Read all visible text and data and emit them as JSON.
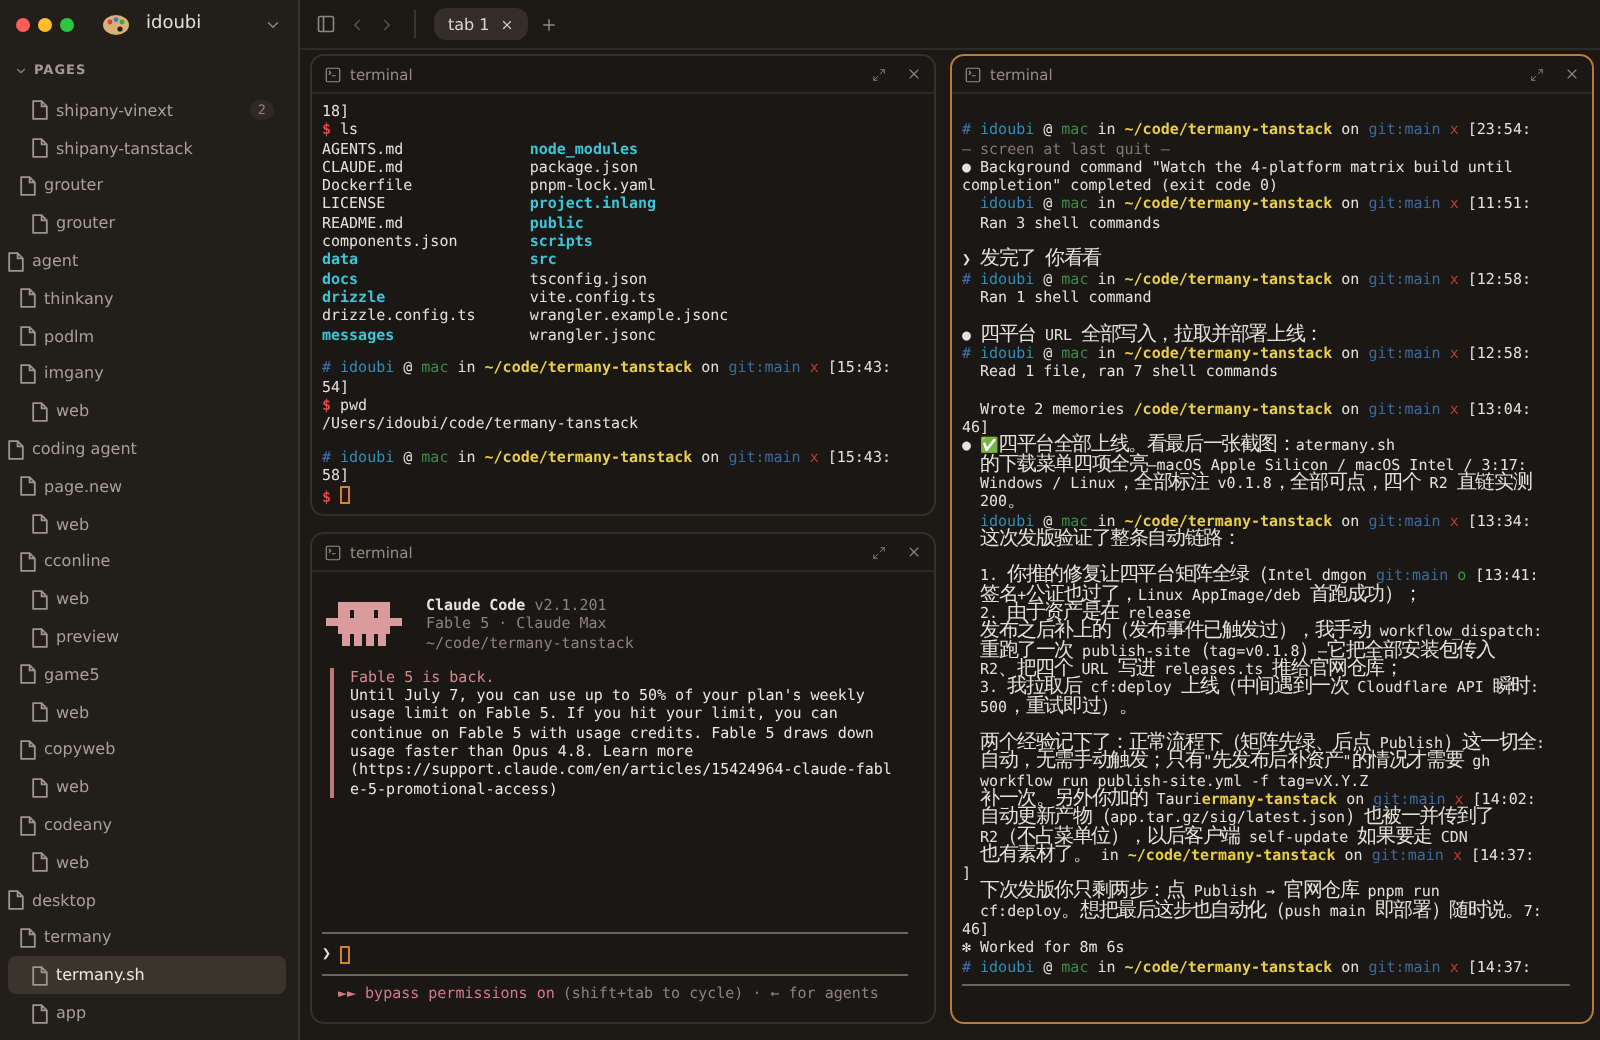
{
  "sidebar": {
    "workspace": "idoubi",
    "section": "PAGES",
    "section_expanded": true,
    "tree": [
      {
        "children": [
          {
            "children": [
              {
                "label": "shipany-vinext",
                "badge": "2",
                "selected": false
              },
              {
                "label": "shipany-tanstack",
                "selected": false
              }
            ]
          },
          {
            "label": "grouter",
            "selected": false,
            "children": [
              {
                "label": "grouter",
                "selected": false
              }
            ]
          }
        ]
      },
      {
        "label": "agent",
        "selected": false,
        "children": [
          {
            "label": "thinkany",
            "selected": false
          },
          {
            "label": "podlm",
            "selected": false
          },
          {
            "label": "imgany",
            "selected": false,
            "children": [
              {
                "label": "web",
                "selected": false
              }
            ]
          }
        ]
      },
      {
        "label": "coding agent",
        "selected": false,
        "children": [
          {
            "label": "page.new",
            "selected": false,
            "children": [
              {
                "label": "web",
                "selected": false
              }
            ]
          },
          {
            "label": "cconline",
            "selected": false,
            "children": [
              {
                "label": "web",
                "selected": false
              },
              {
                "label": "preview",
                "selected": false
              }
            ]
          },
          {
            "label": "game5",
            "selected": false,
            "children": [
              {
                "label": "web",
                "selected": false
              }
            ]
          },
          {
            "label": "copyweb",
            "selected": false,
            "children": [
              {
                "label": "web",
                "selected": false
              }
            ]
          },
          {
            "label": "codeany",
            "selected": false,
            "children": [
              {
                "label": "web",
                "selected": false
              }
            ]
          }
        ]
      },
      {
        "label": "desktop",
        "selected": false,
        "children": [
          {
            "label": "termany",
            "selected": false,
            "children": [
              {
                "label": "termany.sh",
                "selected": true
              },
              {
                "label": "app",
                "selected": false
              }
            ]
          }
        ]
      }
    ]
  },
  "toolbar": {
    "tabs": [
      {
        "label": "tab 1",
        "selected": true
      }
    ]
  },
  "columns": [
    {
      "panes": [
        {
          "kind": "shell",
          "title": "terminal",
          "focused": false,
          "lines": [
            {
              "kind": "text",
              "segments": [
                {
                  "text": "18]",
                  "kind": "plain"
                }
              ]
            },
            {
              "kind": "text",
              "segments": [
                {
                  "text": "$ ",
                  "kind": "dollar"
                },
                {
                  "text": "ls",
                  "kind": "plain"
                }
              ]
            },
            {
              "kind": "listing",
              "entries": [
                {
                  "text": "AGENTS.md",
                  "kind": "file"
                },
                {
                  "text": "node_modules",
                  "kind": "dir"
                },
                {
                  "text": "CLAUDE.md",
                  "kind": "file"
                },
                {
                  "text": "package.json",
                  "kind": "file"
                },
                {
                  "text": "Dockerfile",
                  "kind": "file"
                },
                {
                  "text": "pnpm-lock.yaml",
                  "kind": "file"
                },
                {
                  "text": "LICENSE",
                  "kind": "file"
                },
                {
                  "text": "project.inlang",
                  "kind": "dir"
                },
                {
                  "text": "README.md",
                  "kind": "file"
                },
                {
                  "text": "public",
                  "kind": "dir"
                },
                {
                  "text": "components.json",
                  "kind": "file"
                },
                {
                  "text": "scripts",
                  "kind": "dir"
                },
                {
                  "text": "data",
                  "kind": "dir"
                },
                {
                  "text": "src",
                  "kind": "dir"
                },
                {
                  "text": "docs",
                  "kind": "dir"
                },
                {
                  "text": "tsconfig.json",
                  "kind": "file"
                },
                {
                  "text": "drizzle",
                  "kind": "dir"
                },
                {
                  "text": "vite.config.ts",
                  "kind": "file"
                },
                {
                  "text": "drizzle.config.ts",
                  "kind": "file"
                },
                {
                  "text": "wrangler.example.jsonc",
                  "kind": "file"
                },
                {
                  "text": "messages",
                  "kind": "dir"
                },
                {
                  "text": "wrangler.jsonc",
                  "kind": "file"
                }
              ]
            },
            {
              "kind": "blank"
            },
            {
              "kind": "text",
              "segments": [
                {
                  "text": "# ",
                  "kind": "hash"
                },
                {
                  "text": "idoubi",
                  "kind": "user"
                },
                {
                  "text": " @ ",
                  "kind": "plain"
                },
                {
                  "text": "mac",
                  "kind": "host"
                },
                {
                  "text": " in ",
                  "kind": "plain"
                },
                {
                  "text": "~/code/termany-tanstack",
                  "kind": "path"
                },
                {
                  "text": " on ",
                  "kind": "plain"
                },
                {
                  "text": "git:main",
                  "kind": "branch"
                },
                {
                  "text": " x",
                  "kind": "dirty"
                },
                {
                  "text": " [15:43:",
                  "kind": "plain"
                }
              ]
            },
            {
              "kind": "text",
              "segments": [
                {
                  "text": "54]",
                  "kind": "plain"
                }
              ]
            },
            {
              "kind": "text",
              "segments": [
                {
                  "text": "$ ",
                  "kind": "dollar"
                },
                {
                  "text": "pwd",
                  "kind": "plain"
                }
              ]
            },
            {
              "kind": "text",
              "segments": [
                {
                  "text": "/Users/idoubi/code/termany-tanstack",
                  "kind": "plain"
                }
              ]
            },
            {
              "kind": "blank"
            },
            {
              "kind": "text",
              "segments": [
                {
                  "text": "# ",
                  "kind": "hash"
                },
                {
                  "text": "idoubi",
                  "kind": "user"
                },
                {
                  "text": " @ ",
                  "kind": "plain"
                },
                {
                  "text": "mac",
                  "kind": "host"
                },
                {
                  "text": " in ",
                  "kind": "plain"
                },
                {
                  "text": "~/code/termany-tanstack",
                  "kind": "path"
                },
                {
                  "text": " on ",
                  "kind": "plain"
                },
                {
                  "text": "git:main",
                  "kind": "branch"
                },
                {
                  "text": " x",
                  "kind": "dirty"
                },
                {
                  "text": " [15:43:",
                  "kind": "plain"
                }
              ]
            },
            {
              "kind": "text",
              "segments": [
                {
                  "text": "58]",
                  "kind": "plain"
                }
              ]
            },
            {
              "kind": "input",
              "segments": [
                {
                  "text": "$ ",
                  "kind": "dollar"
                }
              ]
            }
          ]
        },
        {
          "kind": "claude",
          "title": "terminal",
          "focused": false,
          "banner": {
            "name": "Claude Code",
            "version": "v2.1.201",
            "plan": "Fable 5 · Claude Max",
            "cwd": "~/code/termany-tanstack"
          },
          "notice": {
            "title": "Fable 5 is back.",
            "lines": [
              "Until July 7, you can use up to 50% of your plan's weekly",
              "usage limit on Fable 5. If you hit your limit, you can",
              "continue on Fable 5 with usage credits. Fable 5 draws down",
              "usage faster than Opus 4.8. Learn more",
              "(https://support.claude.com/en/articles/15424964-claude-fabl",
              "e-5-promotional-access)"
            ]
          },
          "prompt": "❯",
          "mode": {
            "label": "►► bypass permissions on",
            "hint": "(shift+tab to cycle) · ← for agents"
          }
        }
      ]
    },
    {
      "panes": [
        {
          "kind": "shell",
          "title": "terminal",
          "focused": true,
          "lines": [
            {
              "kind": "blank"
            },
            {
              "kind": "text",
              "segments": [
                {
                  "text": "# ",
                  "kind": "hash"
                },
                {
                  "text": "idoubi",
                  "kind": "user"
                },
                {
                  "text": " @ ",
                  "kind": "plain"
                },
                {
                  "text": "mac",
                  "kind": "host"
                },
                {
                  "text": " in ",
                  "kind": "plain"
                },
                {
                  "text": "~/code/termany-tanstack",
                  "kind": "path"
                },
                {
                  "text": " on ",
                  "kind": "plain"
                },
                {
                  "text": "git:main",
                  "kind": "branch"
                },
                {
                  "text": " x",
                  "kind": "dirty"
                },
                {
                  "text": " [23:54:",
                  "kind": "plain"
                }
              ]
            },
            {
              "kind": "text",
              "segments": [
                {
                  "text": "— screen at last quit —",
                  "kind": "dim"
                }
              ]
            },
            {
              "kind": "text",
              "segments": [
                {
                  "text": "● Background command \"Watch the 4-platform matrix build until",
                  "kind": "plain"
                }
              ]
            },
            {
              "kind": "text",
              "segments": [
                {
                  "text": "completion\" completed (exit code 0)",
                  "kind": "plain"
                }
              ]
            },
            {
              "kind": "text",
              "indent": true,
              "segments": [
                {
                  "text": "idoubi",
                  "kind": "user"
                },
                {
                  "text": " @ ",
                  "kind": "plain"
                },
                {
                  "text": "mac",
                  "kind": "host"
                },
                {
                  "text": " in ",
                  "kind": "plain"
                },
                {
                  "text": "~/code/termany-tanstack",
                  "kind": "path"
                },
                {
                  "text": " on ",
                  "kind": "plain"
                },
                {
                  "text": "git:main",
                  "kind": "branch"
                },
                {
                  "text": " x",
                  "kind": "dirty"
                },
                {
                  "text": " [11:51:",
                  "kind": "plain"
                }
              ]
            },
            {
              "kind": "text",
              "segments": [
                {
                  "text": "  Ran 3 shell commands",
                  "kind": "plain"
                }
              ]
            },
            {
              "kind": "blank"
            },
            {
              "kind": "text",
              "segments": [
                {
                  "text": "❯ 发完了 你看看",
                  "kind": "plain"
                }
              ]
            },
            {
              "kind": "text",
              "segments": [
                {
                  "text": "# ",
                  "kind": "hash"
                },
                {
                  "text": "idoubi",
                  "kind": "user"
                },
                {
                  "text": " @ ",
                  "kind": "plain"
                },
                {
                  "text": "mac",
                  "kind": "host"
                },
                {
                  "text": " in ",
                  "kind": "plain"
                },
                {
                  "text": "~/code/termany-tanstack",
                  "kind": "path"
                },
                {
                  "text": " on ",
                  "kind": "plain"
                },
                {
                  "text": "git:main",
                  "kind": "branch"
                },
                {
                  "text": " x",
                  "kind": "dirty"
                },
                {
                  "text": " [12:58:",
                  "kind": "plain"
                }
              ]
            },
            {
              "kind": "text",
              "segments": [
                {
                  "text": "  Ran 1 shell command",
                  "kind": "plain"
                }
              ]
            },
            {
              "kind": "blank"
            },
            {
              "kind": "text",
              "segments": [
                {
                  "text": "● 四平台 URL 全部写入，拉取并部署上线：",
                  "kind": "plain"
                }
              ]
            },
            {
              "kind": "text",
              "segments": [
                {
                  "text": "# ",
                  "kind": "hash"
                },
                {
                  "text": "idoubi",
                  "kind": "user"
                },
                {
                  "text": " @ ",
                  "kind": "plain"
                },
                {
                  "text": "mac",
                  "kind": "host"
                },
                {
                  "text": " in ",
                  "kind": "plain"
                },
                {
                  "text": "~/code/termany-tanstack",
                  "kind": "path"
                },
                {
                  "text": " on ",
                  "kind": "plain"
                },
                {
                  "text": "git:main",
                  "kind": "branch"
                },
                {
                  "text": " x",
                  "kind": "dirty"
                },
                {
                  "text": " [12:58:",
                  "kind": "plain"
                }
              ]
            },
            {
              "kind": "text",
              "segments": [
                {
                  "text": "  Read 1 file, ran 7 shell commands",
                  "kind": "plain"
                }
              ]
            },
            {
              "kind": "blank"
            },
            {
              "kind": "text",
              "segments": [
                {
                  "text": "  Wrote 2 memories ",
                  "kind": "plain"
                },
                {
                  "text": "/code/termany-tanstack",
                  "kind": "path"
                },
                {
                  "text": " on ",
                  "kind": "plain"
                },
                {
                  "text": "git:main",
                  "kind": "branch"
                },
                {
                  "text": " x",
                  "kind": "dirty"
                },
                {
                  "text": " [13:04:",
                  "kind": "plain"
                }
              ]
            },
            {
              "kind": "text",
              "segments": [
                {
                  "text": "46]",
                  "kind": "plain"
                }
              ]
            },
            {
              "kind": "text",
              "segments": [
                {
                  "text": "● ✅四平台全部上线。看最后一张截图：atermany.sh",
                  "kind": "plain"
                }
              ]
            },
            {
              "kind": "text",
              "segments": [
                {
                  "text": "  的下载菜单四项全亮—macOS Apple Silicon / macOS Intel / 3:17:",
                  "kind": "plain"
                }
              ]
            },
            {
              "kind": "text",
              "segments": [
                {
                  "text": "  Windows / Linux，全部标注 v0.1.8，全部可点，四个 R2 直链实测",
                  "kind": "plain"
                }
              ]
            },
            {
              "kind": "text",
              "segments": [
                {
                  "text": "  200。",
                  "kind": "plain"
                }
              ]
            },
            {
              "kind": "text",
              "indent": true,
              "segments": [
                {
                  "text": "idoubi",
                  "kind": "user"
                },
                {
                  "text": " @ ",
                  "kind": "plain"
                },
                {
                  "text": "mac",
                  "kind": "host"
                },
                {
                  "text": " in ",
                  "kind": "plain"
                },
                {
                  "text": "~/code/termany-tanstack",
                  "kind": "path"
                },
                {
                  "text": " on ",
                  "kind": "plain"
                },
                {
                  "text": "git:main",
                  "kind": "branch"
                },
                {
                  "text": " x",
                  "kind": "dirty"
                },
                {
                  "text": " [13:34:",
                  "kind": "plain"
                }
              ]
            },
            {
              "kind": "text",
              "segments": [
                {
                  "text": "  这次发版验证了整条自动链路：",
                  "kind": "plain"
                }
              ]
            },
            {
              "kind": "blank"
            },
            {
              "kind": "text",
              "segments": [
                {
                  "text": "  1. 你推的修复让四平台矩阵全绿（Intel dmgon ",
                  "kind": "plain"
                },
                {
                  "text": "git:main",
                  "kind": "branch"
                },
                {
                  "text": " o",
                  "kind": "clean"
                },
                {
                  "text": " [13:41:",
                  "kind": "plain"
                }
              ]
            },
            {
              "kind": "text",
              "segments": [
                {
                  "text": "  签名+公证也过了，Linux AppImage/deb 首跑成功）；",
                  "kind": "plain"
                }
              ]
            },
            {
              "kind": "text",
              "segments": [
                {
                  "text": "  2. 由于资产是在 release",
                  "kind": "plain"
                }
              ]
            },
            {
              "kind": "text",
              "segments": [
                {
                  "text": "  发布之后补上的（发布事件已触发过），我手动 workflow_dispatch:",
                  "kind": "plain"
                }
              ]
            },
            {
              "kind": "text",
              "segments": [
                {
                  "text": "  重跑了一次 publish-site（tag=v0.1.8）—它把全部安装包传入",
                  "kind": "plain"
                }
              ]
            },
            {
              "kind": "text",
              "segments": [
                {
                  "text": "  R2、把四个 URL 写进 releases.ts 推给官网仓库；",
                  "kind": "plain"
                }
              ]
            },
            {
              "kind": "text",
              "segments": [
                {
                  "text": "  3. 我拉取后 cf:deploy 上线（中间遇到一次 Cloudflare API 瞬时:",
                  "kind": "plain"
                }
              ]
            },
            {
              "kind": "text",
              "segments": [
                {
                  "text": "  500，重试即过）。",
                  "kind": "plain"
                }
              ]
            },
            {
              "kind": "blank"
            },
            {
              "kind": "text",
              "segments": [
                {
                  "text": "  两个经验记下了：正常流程下（矩阵先绿、后点 Publish）这一切全:",
                  "kind": "plain"
                }
              ]
            },
            {
              "kind": "text",
              "segments": [
                {
                  "text": "  自动，无需手动触发；只有\"先发布后补资产\"的情况才需要 gh",
                  "kind": "plain"
                }
              ]
            },
            {
              "kind": "text",
              "segments": [
                {
                  "text": "  workflow run publish-site.yml -f tag=vX.Y.Z",
                  "kind": "plain"
                }
              ]
            },
            {
              "kind": "text",
              "segments": [
                {
                  "text": "  补一次。另外你加的 Tauri",
                  "kind": "plain"
                },
                {
                  "text": "ermany-tanstack",
                  "kind": "path"
                },
                {
                  "text": " on ",
                  "kind": "plain"
                },
                {
                  "text": "git:main",
                  "kind": "branch"
                },
                {
                  "text": " x",
                  "kind": "dirty"
                },
                {
                  "text": " [14:02:",
                  "kind": "plain"
                }
              ]
            },
            {
              "kind": "text",
              "segments": [
                {
                  "text": "  自动更新产物（app.tar.gz/sig/latest.json）也被一并传到了",
                  "kind": "plain"
                }
              ]
            },
            {
              "kind": "text",
              "segments": [
                {
                  "text": "  R2（不占菜单位），以后客户端 self-update 如果要走 CDN",
                  "kind": "plain"
                }
              ]
            },
            {
              "kind": "text",
              "segments": [
                {
                  "text": "  也有素材了。 in ",
                  "kind": "plain"
                },
                {
                  "text": "~/code/termany-tanstack",
                  "kind": "path"
                },
                {
                  "text": " on ",
                  "kind": "plain"
                },
                {
                  "text": "git:main",
                  "kind": "branch"
                },
                {
                  "text": " x",
                  "kind": "dirty"
                },
                {
                  "text": " [14:37:",
                  "kind": "plain"
                }
              ]
            },
            {
              "kind": "text",
              "segments": [
                {
                  "text": "]",
                  "kind": "plain"
                }
              ]
            },
            {
              "kind": "text",
              "segments": [
                {
                  "text": "  下次发版你只剩两步：点 Publish → 官网仓库 pnpm run",
                  "kind": "plain"
                }
              ]
            },
            {
              "kind": "text",
              "segments": [
                {
                  "text": "  cf:deploy。想把最后这步也自动化（push main 即部署）随时说。7:",
                  "kind": "plain"
                }
              ]
            },
            {
              "kind": "text",
              "segments": [
                {
                  "text": "46]",
                  "kind": "plain"
                }
              ]
            },
            {
              "kind": "text",
              "segments": [
                {
                  "text": "✻ Worked for 8m 6s",
                  "kind": "plain"
                }
              ]
            },
            {
              "kind": "text",
              "segments": [
                {
                  "text": "# ",
                  "kind": "hash"
                },
                {
                  "text": "idoubi",
                  "kind": "user"
                },
                {
                  "text": " @ ",
                  "kind": "plain"
                },
                {
                  "text": "mac",
                  "kind": "host"
                },
                {
                  "text": " in ",
                  "kind": "plain"
                },
                {
                  "text": "~/code/termany-tanstack",
                  "kind": "path"
                },
                {
                  "text": " on ",
                  "kind": "plain"
                },
                {
                  "text": "git:main",
                  "kind": "branch"
                },
                {
                  "text": " x",
                  "kind": "dirty"
                },
                {
                  "text": " [14:37:",
                  "kind": "plain"
                }
              ]
            },
            {
              "kind": "rule"
            }
          ]
        }
      ]
    }
  ]
}
